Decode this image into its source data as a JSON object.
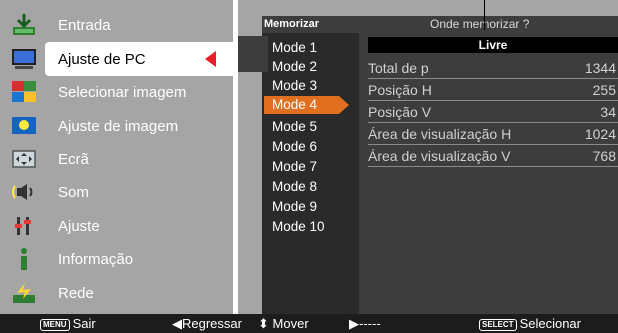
{
  "menu": {
    "items": [
      {
        "label": "Entrada",
        "icon": "input-icon"
      },
      {
        "label": "Ajuste de PC",
        "icon": "pc-adjust-icon"
      },
      {
        "label": "Selecionar imagem",
        "icon": "image-select-icon"
      },
      {
        "label": "Ajuste de imagem",
        "icon": "image-adjust-icon"
      },
      {
        "label": "Ecrã",
        "icon": "screen-icon"
      },
      {
        "label": "Som",
        "icon": "sound-icon"
      },
      {
        "label": "Ajuste",
        "icon": "setting-icon"
      },
      {
        "label": "Informação",
        "icon": "information-icon"
      },
      {
        "label": "Rede",
        "icon": "network-icon"
      }
    ],
    "selected": "Ajuste de PC"
  },
  "header": {
    "memorize": "Memorizar",
    "where": "Onde memorizar ?"
  },
  "modes": [
    "Mode 1",
    "Mode 2",
    "Mode 3",
    "Mode 4",
    "Mode 5",
    "Mode 6",
    "Mode 7",
    "Mode 8",
    "Mode 9",
    "Mode 10"
  ],
  "selected_mode": "Mode 4",
  "status": "Livre",
  "info": [
    {
      "label": "Total de p",
      "value": "1344"
    },
    {
      "label": "Posição H",
      "value": "255"
    },
    {
      "label": "Posição V",
      "value": "34"
    },
    {
      "label": "Área de visualização H",
      "value": "1024"
    },
    {
      "label": "Área de visualização V",
      "value": "768"
    }
  ],
  "footer": {
    "exit_key": "MENU",
    "exit": "Sair",
    "back": "Regressar",
    "move": "Mover",
    "next": "-----",
    "select_key": "SELECT",
    "select": "Selecionar"
  },
  "colors": {
    "menu_bg": "#a5a5a5",
    "panel_dark": "#3d3d3d",
    "highlight": "#e07020",
    "selected_arrow": "#e8202a"
  }
}
